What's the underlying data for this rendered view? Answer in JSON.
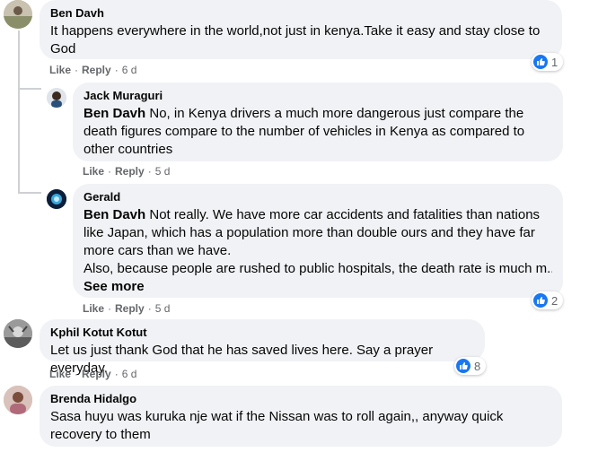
{
  "accent": "#1877f2",
  "comments": [
    {
      "author": "Ben Davh",
      "text": "It happens everywhere in the world,not just in kenya.Take it easy and stay close to God",
      "actions": {
        "like": "Like",
        "reply": "Reply",
        "time": "6 d"
      },
      "reactions": "1"
    },
    {
      "author": "Jack Muraguri",
      "mention": "Ben Davh",
      "text": "No, in Kenya drivers a much more dangerous just compare the death figures compare to the number of vehicles in Kenya as compared to other countries",
      "actions": {
        "like": "Like",
        "reply": "Reply",
        "time": "5 d"
      }
    },
    {
      "author": "Gerald",
      "mention": "Ben Davh",
      "text": "Not really. We have more car accidents and fatalities than nations like Japan, which has a population more than double ours and they have far more cars than we have.",
      "text2": "Also, because people are rushed to public hospitals, the death rate is much m...",
      "see_more": "See more",
      "actions": {
        "like": "Like",
        "reply": "Reply",
        "time": "5 d"
      },
      "reactions": "2"
    },
    {
      "author": "Kphil Kotut Kotut",
      "text": "Let us just thank God that he has saved lives here. Say a prayer everyday.",
      "actions": {
        "like": "Like",
        "reply": "Reply",
        "time": "6 d"
      },
      "reactions": "8"
    },
    {
      "author": "Brenda Hidalgo",
      "text": "Sasa huyu was kuruka nje wat if the Nissan was to roll again,, anyway quick recovery to them"
    }
  ]
}
